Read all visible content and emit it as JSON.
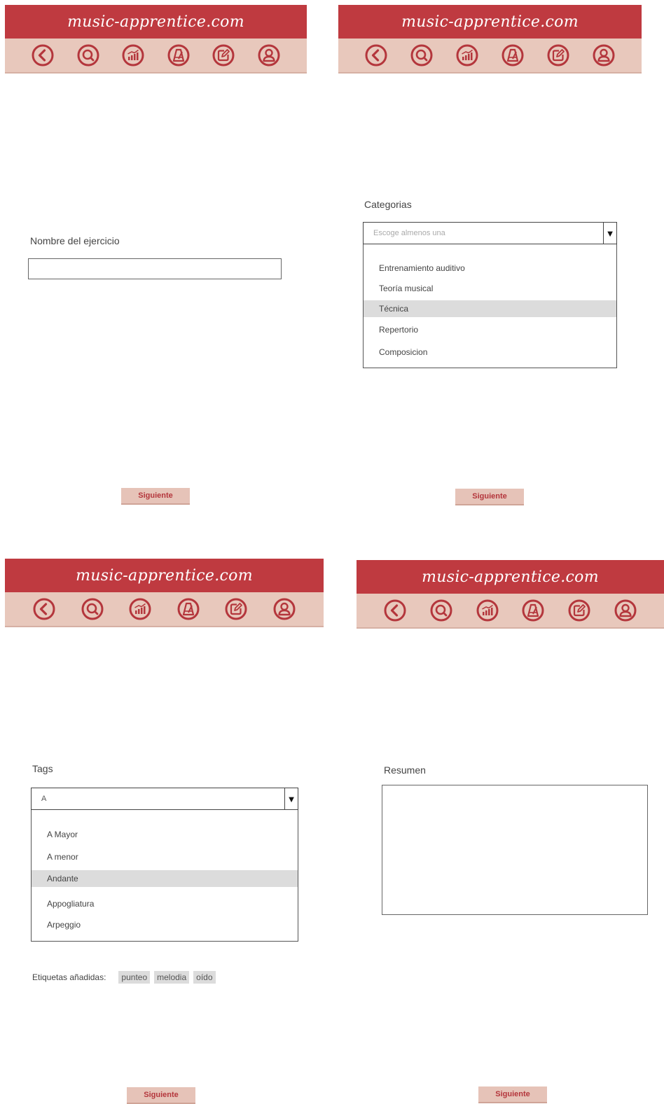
{
  "brand": {
    "site_title": "music-apprentice.com",
    "primary_color": "#bf3a40",
    "nav_color": "#e8c8bc"
  },
  "nav_icons": [
    "back-icon",
    "search-icon",
    "stats-icon",
    "metronome-icon",
    "edit-icon",
    "profile-icon"
  ],
  "screen1": {
    "label": "Nombre del ejercicio",
    "input_value": "",
    "button": "Siguiente"
  },
  "screen2": {
    "label": "Categorias",
    "placeholder": "Escoge almenos una",
    "options": [
      "Entrenamiento auditivo",
      "Teoría musical",
      "Técnica",
      "Repertorio",
      "Composicion"
    ],
    "selected_index": 2,
    "button": "Siguiente"
  },
  "screen3": {
    "label": "Tags",
    "input_value": "A",
    "options": [
      "A Mayor",
      "A menor",
      "Andante",
      "Appogliatura",
      "Arpeggio"
    ],
    "selected_index": 2,
    "added_label": "Etiquetas añadidas:",
    "added_tags": [
      "punteo",
      "melodia",
      "oído"
    ],
    "button": "Siguiente"
  },
  "screen4": {
    "label": "Resumen",
    "textarea_value": "",
    "button": "Siguiente"
  }
}
